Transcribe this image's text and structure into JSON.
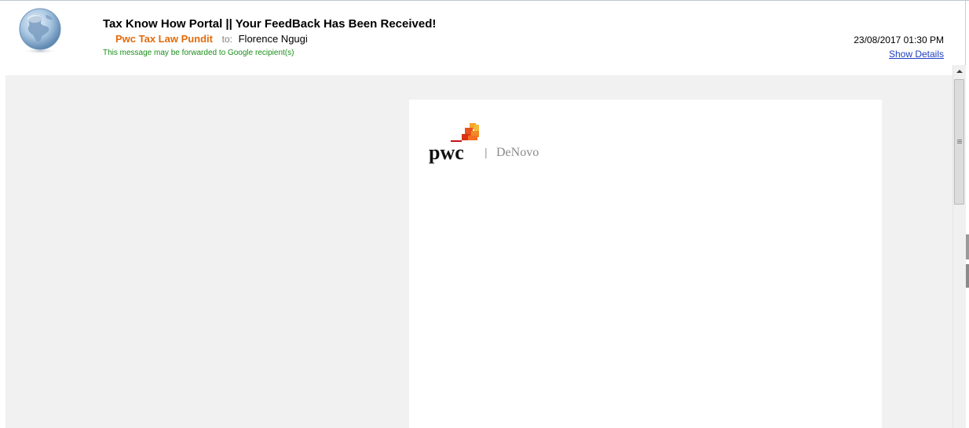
{
  "email": {
    "subject": "Tax Know How Portal || Your FeedBack Has Been Received!",
    "sender": "Pwc Tax Law Pundit",
    "to_label": "to:",
    "recipient": "Florence Ngugi",
    "forward_notice": "This message may be forwarded to Google recipient(s)",
    "datetime": "23/08/2017 01:30 PM",
    "show_details_label": "Show Details"
  },
  "logo": {
    "brand": "pwc",
    "divider": "|",
    "product": "DeNovo"
  },
  "icons": {
    "avatar": "globe-icon",
    "scroll_up": "chevron-up-icon",
    "scroll_grip": "grip-icon"
  },
  "colors": {
    "sender": "#e26b0a",
    "notice": "#1a8f1a",
    "link": "#1f3fbf",
    "body_background": "#f1f1f1"
  }
}
